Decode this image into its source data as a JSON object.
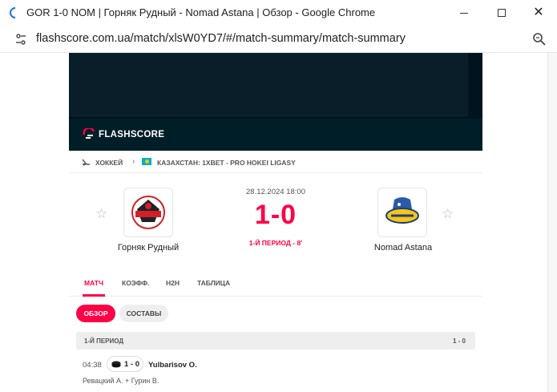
{
  "window": {
    "title": "GOR 1-0 NOM | Горняк Рудный - Nomad Astana | Обзор - Google Chrome",
    "url": "flashscore.com.ua/match/xlsW0YD7/#/match-summary/match-summary"
  },
  "brand": {
    "name": "FLASHSCORE"
  },
  "breadcrumb": {
    "sport": "ХОККЕЙ",
    "league": "КАЗАХСТАН: 1XBET - PRO HOKEI LIGASY"
  },
  "match": {
    "home": "Горняк Рудный",
    "away": "Nomad Astana",
    "date": "28.12.2024 18:00",
    "score": "1-0",
    "status": "1-Й ПЕРИОД - 8'"
  },
  "tabs": [
    "МАТЧ",
    "КОЭФФ.",
    "H2H",
    "ТАБЛИЦА"
  ],
  "subtabs": [
    "ОБЗОР",
    "СОСТАВЫ"
  ],
  "period": {
    "title": "1-Й ПЕРИОД",
    "score": "1 - 0"
  },
  "event": {
    "time": "04:38",
    "score": "1 - 0",
    "player": "Yulbarisov O.",
    "assists": "Ревацкий А. + Гурин В."
  },
  "colors": {
    "accent": "#ff0046",
    "banner": "#00141e"
  }
}
